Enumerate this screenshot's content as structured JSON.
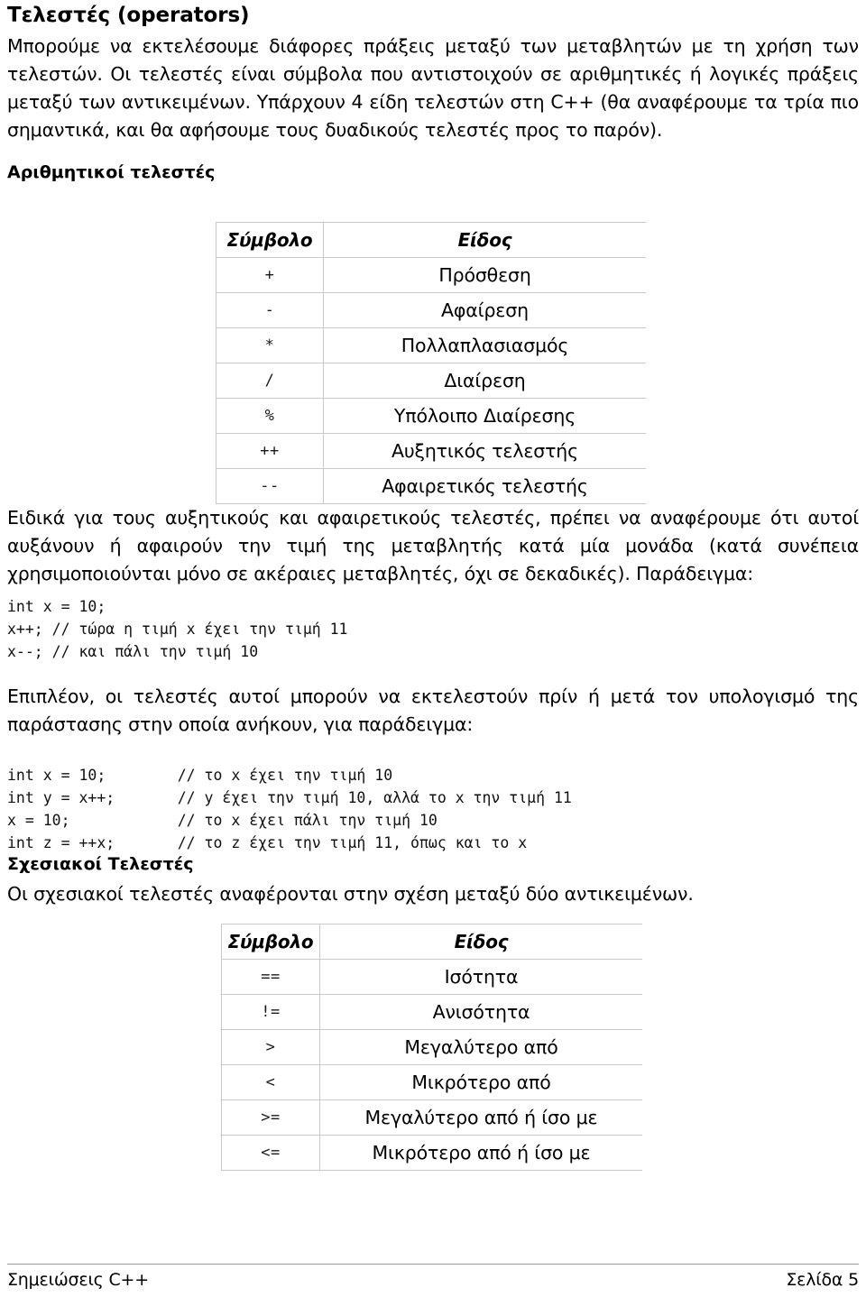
{
  "document": {
    "title": "Τελεστές (operators)"
  },
  "intro": {
    "paragraph": "Μπορούμε να εκτελέσουμε διάφορες πράξεις μεταξύ των μεταβλητών με τη χρήση των τελεστών. Οι τελεστές είναι σύμβολα που αντιστοιχούν σε αριθμητικές ή λογικές πράξεις μεταξύ των αντικειμένων. Υπάρχουν 4 είδη τελεστών στη C++ (θα αναφέρουμε τα τρία πιο σημαντικά, και θα αφήσουμε τους δυαδικούς τελεστές προς το παρόν)."
  },
  "arithmetic": {
    "heading": "Αριθμητικοί τελεστές",
    "table": {
      "headers": [
        "Σύμβολο",
        "Είδος"
      ],
      "rows": [
        {
          "symbol": "+",
          "kind": "Πρόσθεση"
        },
        {
          "symbol": "-",
          "kind": "Αφαίρεση"
        },
        {
          "symbol": "*",
          "kind": "Πολλαπλασιασμός"
        },
        {
          "symbol": "/",
          "kind": "Διαίρεση"
        },
        {
          "symbol": "%",
          "kind": "Υπόλοιπο Διαίρεσης"
        },
        {
          "symbol": "++",
          "kind": "Αυξητικός τελεστής"
        },
        {
          "symbol": "--",
          "kind": "Αφαιρετικός τελεστής"
        }
      ]
    },
    "incdec_paragraph": "Ειδικά για τους αυξητικούς και αφαιρετικούς τελεστές, πρέπει να αναφέρουμε ότι αυτοί αυξάνουν ή αφαιρούν την τιμή της μεταβλητής κατά μία μονάδα (κατά συνέπεια χρησιμοποιούνται μόνο σε ακέραιες μεταβλητές, όχι σε δεκαδικές). Παράδειγμα:",
    "code_block_1": "int x = 10;\nx++; // τώρα η τιμή x έχει την τιμή 11\nx--; // και πάλι την τιμή 10",
    "prepost_paragraph": "Επιπλέον, οι τελεστές αυτοί μπορούν να εκτελεστούν πρίν ή μετά τον υπολογισμό της παράστασης στην οποία ανήκουν, για παράδειγμα:",
    "code_block_2": "int x = 10;        // το x έχει την τιμή 10\nint y = x++;       // y έχει την τιμή 10, αλλά το x την τιμή 11\nx = 10;            // το x έχει πάλι την τιμή 10\nint z = ++x;       // το z έχει την τιμή 11, όπως και το x"
  },
  "relational": {
    "heading": "Σχεσιακοί Τελεστές",
    "paragraph": "Οι σχεσιακοί τελεστές αναφέρονται στην σχέση μεταξύ δύο αντικειμένων.",
    "table": {
      "headers": [
        "Σύμβολο",
        "Είδος"
      ],
      "rows": [
        {
          "symbol": "==",
          "kind": "Ισότητα"
        },
        {
          "symbol": "!=",
          "kind": "Ανισότητα"
        },
        {
          "symbol": ">",
          "kind": "Μεγαλύτερο από"
        },
        {
          "symbol": "<",
          "kind": "Μικρότερο από"
        },
        {
          "symbol": ">=",
          "kind": "Μεγαλύτερο από ή ίσο με"
        },
        {
          "symbol": "<=",
          "kind": "Μικρότερο από ή ίσο με"
        }
      ]
    }
  },
  "footer": {
    "left": "Σημειώσεις C++",
    "right": "Σελίδα 5"
  }
}
